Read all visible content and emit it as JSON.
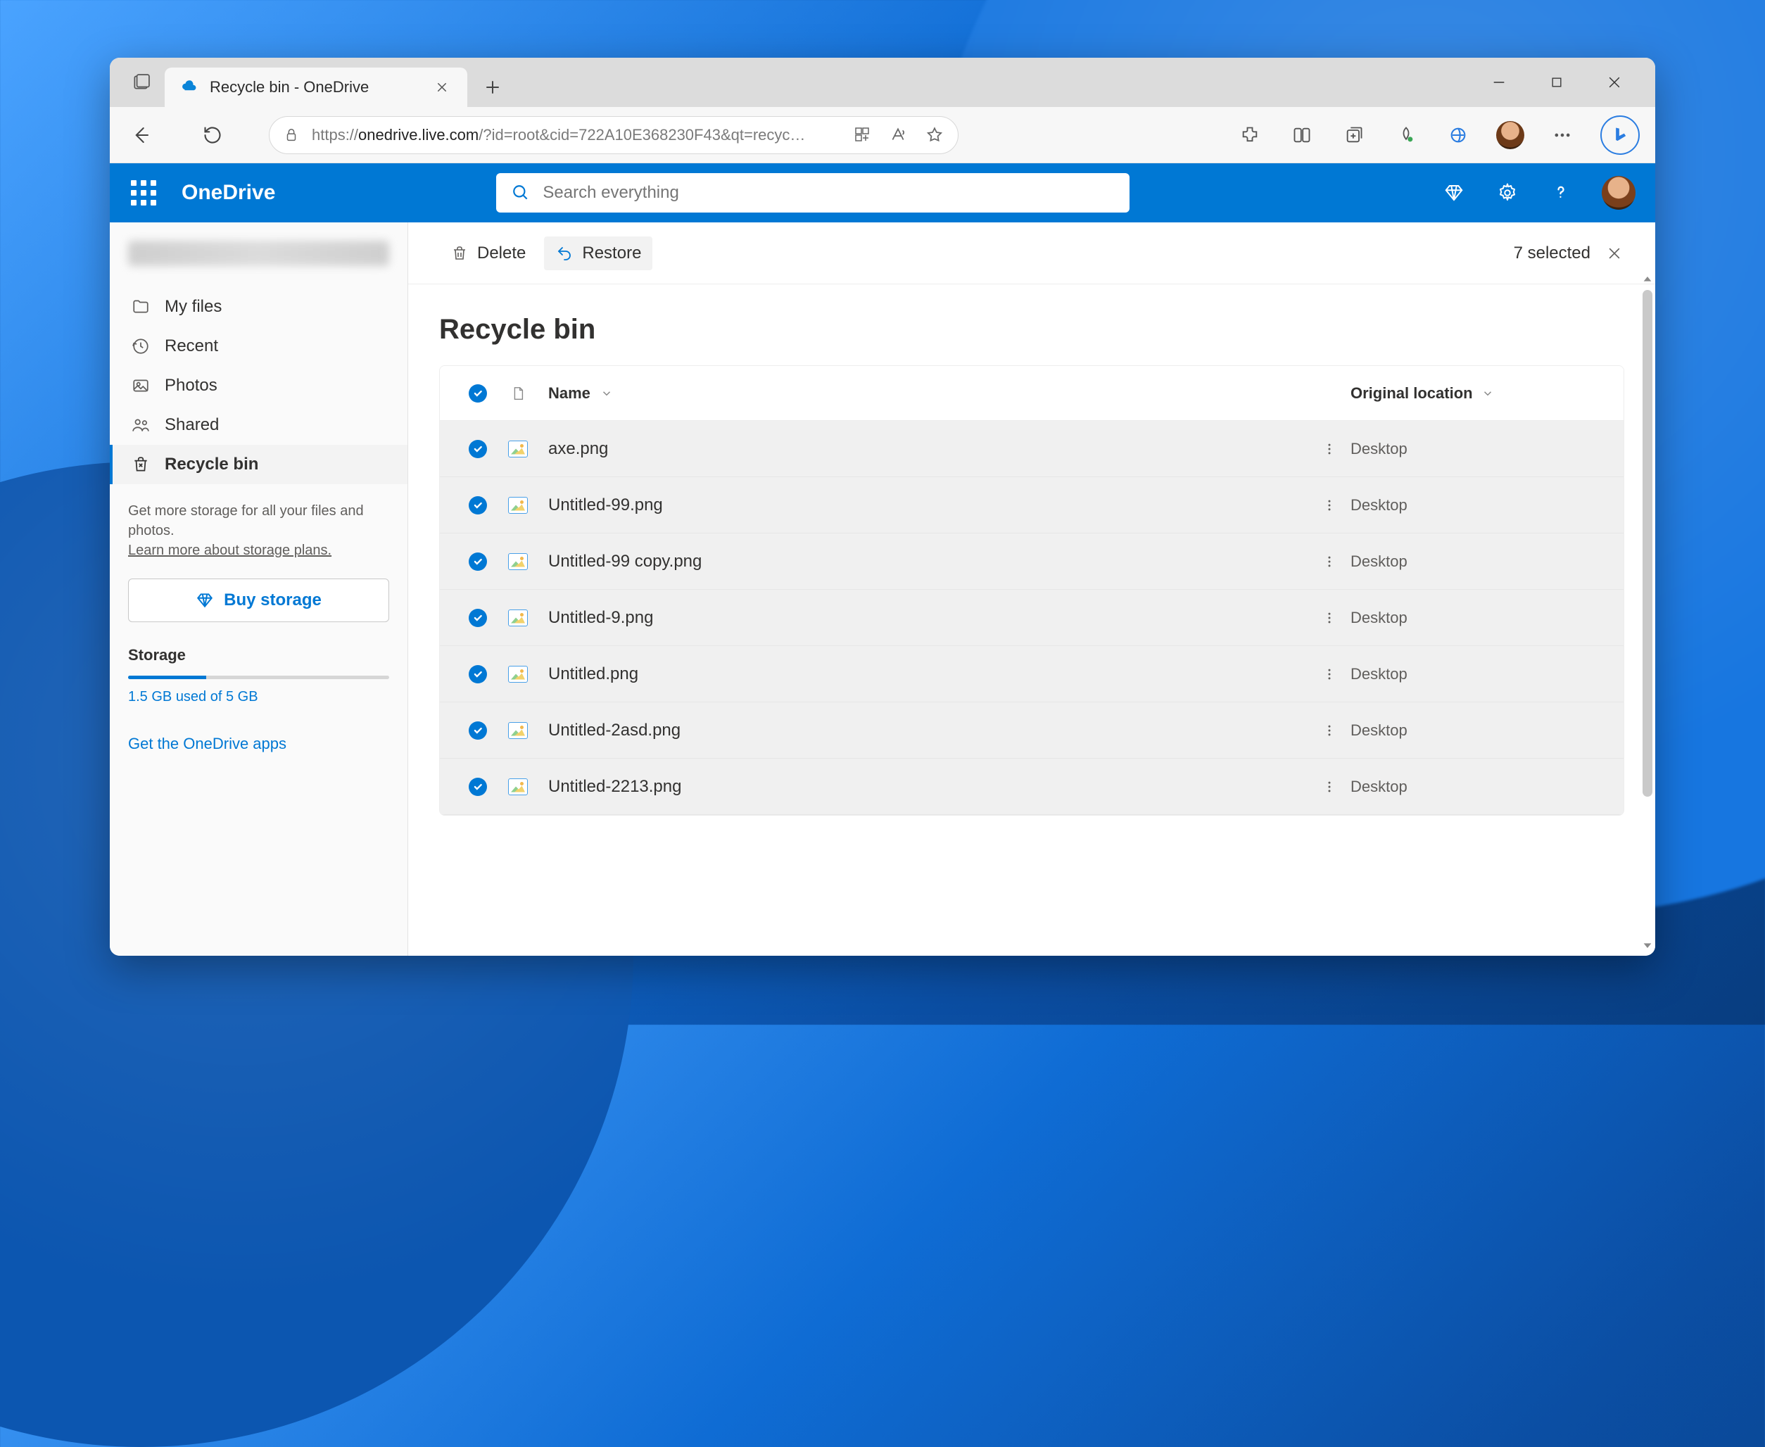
{
  "browser": {
    "tab_title": "Recycle bin - OneDrive",
    "url_host": "onedrive.live.com",
    "url_prefix": "https://",
    "url_rest": "/?id=root&cid=722A10E368230F43&qt=recyc…"
  },
  "header": {
    "brand": "OneDrive",
    "search_placeholder": "Search everything"
  },
  "sidebar": {
    "items": [
      {
        "label": "My files"
      },
      {
        "label": "Recent"
      },
      {
        "label": "Photos"
      },
      {
        "label": "Shared"
      },
      {
        "label": "Recycle bin"
      }
    ],
    "storage_note": "Get more storage for all your files and photos.",
    "storage_learn": "Learn more about storage plans.",
    "buy_label": "Buy storage",
    "storage_title": "Storage",
    "storage_used": "1.5 GB used of 5 GB",
    "get_apps": "Get the OneDrive apps"
  },
  "commands": {
    "delete": "Delete",
    "restore": "Restore",
    "selected": "7 selected"
  },
  "page": {
    "title": "Recycle bin"
  },
  "table": {
    "col_name": "Name",
    "col_location": "Original location",
    "rows": [
      {
        "name": "axe.png",
        "location": "Desktop"
      },
      {
        "name": "Untitled-99.png",
        "location": "Desktop"
      },
      {
        "name": "Untitled-99 copy.png",
        "location": "Desktop"
      },
      {
        "name": "Untitled-9.png",
        "location": "Desktop"
      },
      {
        "name": "Untitled.png",
        "location": "Desktop"
      },
      {
        "name": "Untitled-2asd.png",
        "location": "Desktop"
      },
      {
        "name": "Untitled-2213.png",
        "location": "Desktop"
      }
    ]
  }
}
